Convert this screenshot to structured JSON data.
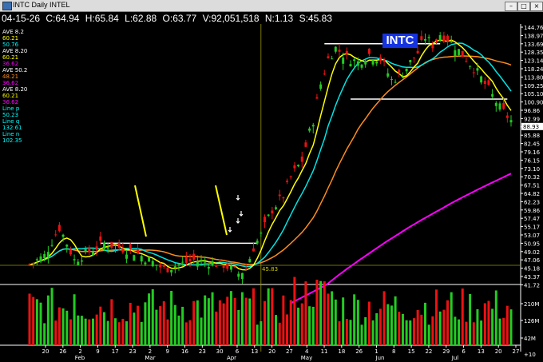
{
  "window": {
    "title": "INTC Daily INTEL"
  },
  "header": {
    "date": "04-15-26",
    "close": "C:64.94",
    "high": "H:65.84",
    "low": "L:62.88",
    "open": "O:63.77",
    "volume": "V:92,051,518",
    "net": "N:1.13",
    "s": "S:45.83"
  },
  "badge": "INTC",
  "indicators": [
    {
      "label": "AVE",
      "value": "8.2",
      "color": "#ffffff"
    },
    {
      "label": "",
      "value": "60.21",
      "color": "#ffff00"
    },
    {
      "label": "",
      "value": "50.76",
      "color": "#00ffff"
    },
    {
      "label": "AVE",
      "value": "8.20",
      "color": "#ffffff"
    },
    {
      "label": "",
      "value": "60.21",
      "color": "#ffff00"
    },
    {
      "label": "",
      "value": "36.62",
      "color": "#ff00ff"
    },
    {
      "label": "AVE",
      "value": "50.2",
      "color": "#ffffff"
    },
    {
      "label": "",
      "value": "48.21",
      "color": "#ff8c1a"
    },
    {
      "label": "",
      "value": "36.62",
      "color": "#ff00ff"
    },
    {
      "label": "AVE",
      "value": "8.20",
      "color": "#ffffff"
    },
    {
      "label": "",
      "value": "60.21",
      "color": "#ffff00"
    },
    {
      "label": "",
      "value": "36.62",
      "color": "#ff00ff"
    },
    {
      "label": "Line",
      "value": "p",
      "color": "#00ffff"
    },
    {
      "label": "",
      "value": "50.23",
      "color": "#00ffff"
    },
    {
      "label": "Line",
      "value": "q",
      "color": "#00ffff"
    },
    {
      "label": "",
      "value": "132.61",
      "color": "#00ffff"
    },
    {
      "label": "Line",
      "value": "n",
      "color": "#00ffff"
    },
    {
      "label": "",
      "value": "102.35",
      "color": "#00ffff"
    }
  ],
  "chart_data": {
    "type": "candlestick",
    "title": "INTC Daily",
    "y_ticks": [
      "144.76",
      "138.97",
      "133.69",
      "128.35",
      "123.14",
      "118.24",
      "113.80",
      "109.25",
      "105.10",
      "100.90",
      "96.86",
      "92.99",
      "88.93",
      "85.88",
      "82.45",
      "79.16",
      "76.15",
      "73.10",
      "70.32",
      "67.51",
      "64.82",
      "62.23",
      "59.86",
      "57.47",
      "55.17",
      "53.07",
      "50.95",
      "49.02",
      "47.06",
      "45.18",
      "43.37",
      "41.72"
    ],
    "price_marker": "88.93",
    "level_label": "45.83",
    "volume_ticks": [
      "210M",
      "126M",
      "42M"
    ],
    "volume_scale_label": "+10",
    "x_ticks": [
      "20",
      "26",
      "2",
      "9",
      "17",
      "23",
      "2",
      "9",
      "16",
      "23",
      "30",
      "6",
      "13",
      "20",
      "27",
      "4",
      "11",
      "18",
      "26",
      "1",
      "8",
      "15",
      "22",
      "29",
      "6",
      "13",
      "20",
      "27"
    ],
    "months": [
      "Feb",
      "Mar",
      "Apr",
      "May",
      "Jun",
      "Jul"
    ],
    "horizontal_levels": [
      50.95,
      133.69,
      102.35
    ],
    "colors": {
      "up": "#22cc22",
      "down": "#ee1111",
      "ma_fast": "#ffff00",
      "ma_mid": "#00e5e5",
      "ma_slow": "#ff8c1a",
      "ma_long": "#ff00ff",
      "level_line": "#ffffff"
    }
  }
}
